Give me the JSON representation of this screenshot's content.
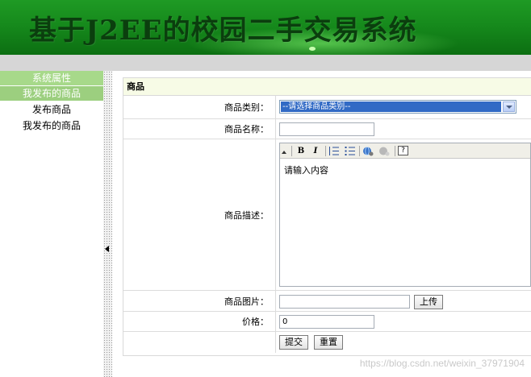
{
  "banner": {
    "title": "基于J2EE的校园二手交易系统"
  },
  "sidebar": {
    "sections": [
      {
        "label": "系统属性"
      },
      {
        "label": "我发布的商品"
      }
    ],
    "items": [
      {
        "label": "发布商品"
      },
      {
        "label": "我发布的商品"
      }
    ]
  },
  "panel": {
    "title": "商品",
    "category": {
      "label": "商品类别：",
      "selected": "--请选择商品类别--"
    },
    "name": {
      "label": "商品名称：",
      "value": ""
    },
    "description": {
      "label": "商品描述：",
      "content": "请输入内容",
      "toolbar": [
        "bold-icon",
        "italic-icon",
        "ordered-list-icon",
        "unordered-list-icon",
        "link-icon",
        "unlink-icon",
        "help-icon"
      ]
    },
    "image": {
      "label": "商品图片：",
      "value": "",
      "upload_label": "上传"
    },
    "price": {
      "label": "价格：",
      "value": "0"
    },
    "submit_label": "提交",
    "reset_label": "重置"
  },
  "watermark": "https://blog.csdn.net/weixin_37971904",
  "colors": {
    "banner": "#168a1c",
    "sidebar_head": "#a7d98a",
    "panel_head": "#f7fbe6",
    "select_highlight": "#316ac5"
  }
}
